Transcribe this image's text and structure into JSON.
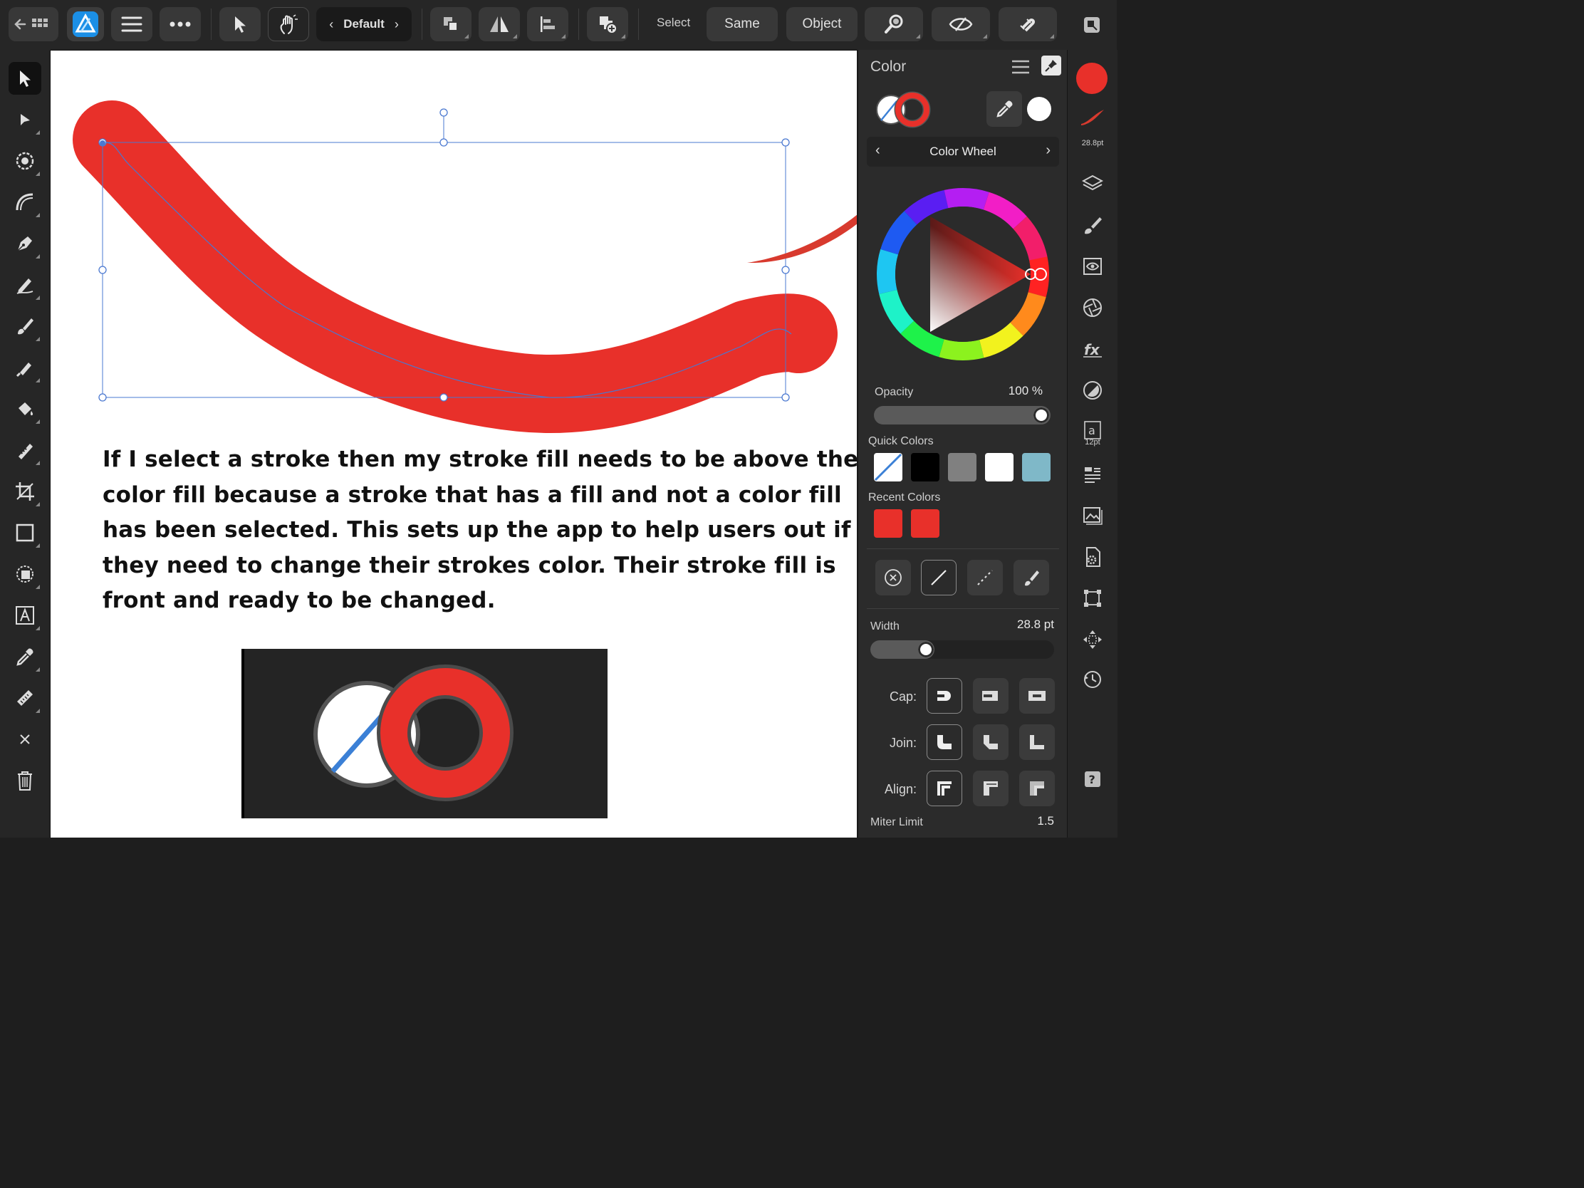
{
  "toolbar": {
    "context_label": "Default",
    "select_label": "Select",
    "same_label": "Same",
    "object_label": "Object"
  },
  "caption": {
    "lines": [
      "If I select a stroke then my stroke fill needs to be above the",
      "color fill because a stroke that has a fill and not a color fill",
      "has been selected. This sets up the app to help users out if",
      "they need to change their strokes color. Their stroke fill is",
      "front and ready to be changed."
    ]
  },
  "panel": {
    "title": "Color",
    "mode_label": "Color Wheel",
    "opacity_label": "Opacity",
    "opacity_value": "100 %",
    "opacity_fraction": 1.0,
    "quick_colors_label": "Quick Colors",
    "quick_colors": [
      "none",
      "#000000",
      "#808080",
      "#ffffff",
      "#7fb8c8"
    ],
    "recent_colors_label": "Recent Colors",
    "recent_colors": [
      "#e8302a",
      "#e8302a"
    ],
    "width_label": "Width",
    "width_value": "28.8 pt",
    "cap_label": "Cap:",
    "join_label": "Join:",
    "align_label": "Align:",
    "miter_label": "Miter Limit",
    "miter_value": "1.5"
  },
  "rightbar": {
    "brush_size": "28.8pt",
    "text_size": "12pt"
  },
  "colors": {
    "stroke_red": "#e8302a",
    "selection_blue": "#4a78d0",
    "accent_blue": "#3b80d6"
  }
}
